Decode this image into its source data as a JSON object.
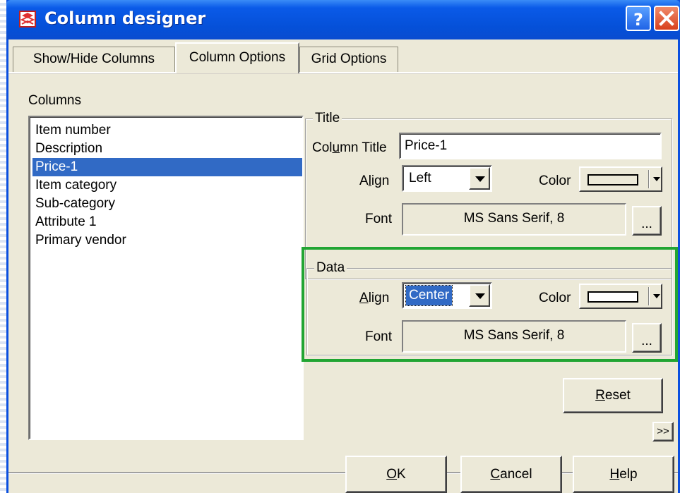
{
  "window": {
    "title": "Column designer",
    "help_glyph": "?",
    "close_glyph": "X"
  },
  "tabs": [
    {
      "label": "Show/Hide Columns",
      "active": false
    },
    {
      "label": "Column Options",
      "active": true
    },
    {
      "label": "Grid Options",
      "active": false
    }
  ],
  "columns": {
    "label": "Columns",
    "items": [
      "Item number",
      "Description",
      "Price-1",
      "Item category",
      "Sub-category",
      "Attribute 1",
      "Primary vendor"
    ],
    "selected": "Price-1"
  },
  "title_group": {
    "legend": "Title",
    "column_title_label_pre": "Col",
    "column_title_label_u": "u",
    "column_title_label_post": "mn Title",
    "column_title_value": "Price-1",
    "align_label_pre": "A",
    "align_label_u": "l",
    "align_label_post": "ign",
    "align_value": "Left",
    "color_label": "Color",
    "font_label": "Font",
    "font_value": "MS Sans Serif, 8",
    "font_button": "..."
  },
  "data_group": {
    "legend": "Data",
    "align_label_u": "A",
    "align_label_post": "lign",
    "align_value": "Center",
    "color_label": "Color",
    "font_label": "Font",
    "font_value": "MS Sans Serif, 8",
    "font_button": "..."
  },
  "buttons": {
    "reset_u": "R",
    "reset_post": "eset",
    "expand": ">>",
    "ok_u": "O",
    "ok_post": "K",
    "cancel_u": "C",
    "cancel_post": "ancel",
    "help_u": "H",
    "help_post": "elp"
  },
  "colors": {
    "titlebar": "#0a5ae8",
    "dialog_bg": "#ece9d8",
    "selection": "#316ac5",
    "highlight_frame": "#21a533"
  }
}
